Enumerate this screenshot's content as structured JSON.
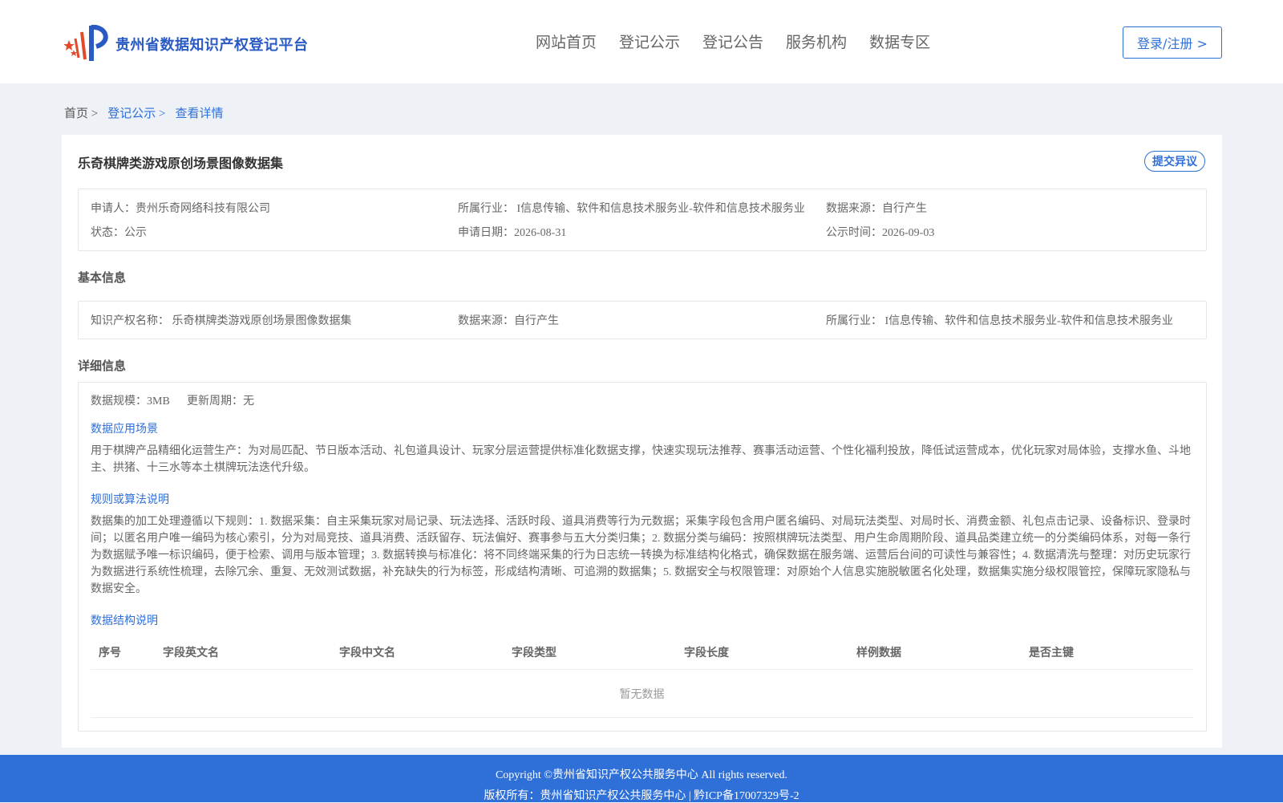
{
  "header": {
    "site_name": "贵州省数据知识产权登记平台",
    "nav": [
      "网站首页",
      "登记公示",
      "登记公告",
      "服务机构",
      "数据专区"
    ],
    "login_label": "登录/注册 >"
  },
  "breadcrumb": {
    "home": "首页 >",
    "section": "登记公示 >",
    "current": "查看详情"
  },
  "detail": {
    "title": "乐奇棋牌类游戏原创场景图像数据集",
    "objection_label": "提交异议",
    "summary": {
      "applicant": "申请人：贵州乐奇网络科技有限公司",
      "industry": "所属行业： I信息传输、软件和信息技术服务业-软件和信息技术服务业",
      "source": "数据来源：自行产生",
      "status": "状态：公示",
      "apply_date": "申请日期：2026-08-31",
      "publish_time": "公示时间：2026-09-03"
    },
    "basic_heading": "基本信息",
    "basic": {
      "ip_name": "知识产权名称： 乐奇棋牌类游戏原创场景图像数据集",
      "source": "数据来源：自行产生",
      "industry": "所属行业： I信息传输、软件和信息技术服务业-软件和信息技术服务业"
    },
    "detail_heading": "详细信息",
    "scale": "数据规模：3MB",
    "update_cycle": "更新周期：无",
    "scenario_heading": "数据应用场景",
    "scenario_text": "用于棋牌产品精细化运营生产：为对局匹配、节日版本活动、礼包道具设计、玩家分层运营提供标准化数据支撑，快速实现玩法推荐、赛事活动运营、个性化福利投放，降低试运营成本，优化玩家对局体验，支撑水鱼、斗地主、拱猪、十三水等本土棋牌玩法迭代升级。",
    "rules_heading": "规则或算法说明",
    "rules_text": "数据集的加工处理遵循以下规则：1. 数据采集：自主采集玩家对局记录、玩法选择、活跃时段、道具消费等行为元数据；采集字段包含用户匿名编码、对局玩法类型、对局时长、消费金额、礼包点击记录、设备标识、登录时间；以匿名用户唯一编码为核心索引，分为对局竞技、道具消费、活跃留存、玩法偏好、赛事参与五大分类归集；2. 数据分类与编码：按照棋牌玩法类型、用户生命周期阶段、道具品类建立统一的分类编码体系，对每一条行为数据赋予唯一标识编码，便于检索、调用与版本管理；3. 数据转换与标准化：将不同终端采集的行为日志统一转换为标准结构化格式，确保数据在服务端、运营后台间的可读性与兼容性；4. 数据清洗与整理：对历史玩家行为数据进行系统性梳理，去除冗余、重复、无效测试数据，补充缺失的行为标签，形成结构清晰、可追溯的数据集；5. 数据安全与权限管理：对原始个人信息实施脱敏匿名化处理，数据集实施分级权限管控，保障玩家隐私与数据安全。",
    "structure_heading": "数据结构说明",
    "table_headers": [
      "序号",
      "字段英文名",
      "字段中文名",
      "字段类型",
      "字段长度",
      "样例数据",
      "是否主键"
    ],
    "empty_text": "暂无数据"
  },
  "footer": {
    "copyright": "Copyright ©贵州省知识产权公共服务中心 All rights reserved.",
    "owner": "版权所有：贵州省知识产权公共服务中心 | 黔ICP备17007329号-2"
  },
  "colors": {
    "accent": "#2f6fd8",
    "background": "#eef2f6"
  }
}
